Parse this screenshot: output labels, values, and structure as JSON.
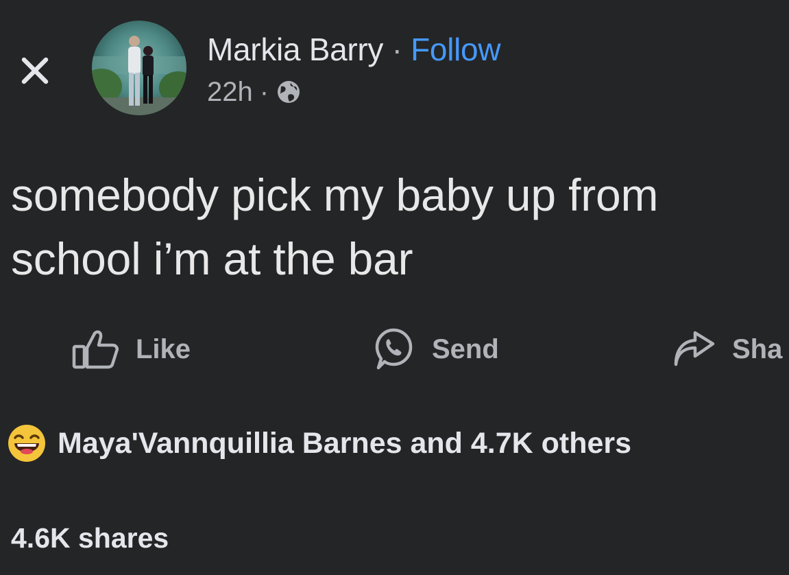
{
  "post": {
    "author_name": "Markia Barry",
    "separator": "·",
    "follow_label": "Follow",
    "timestamp": "22h",
    "meta_separator": "·",
    "privacy_icon": "globe-icon",
    "text_lines": [
      "somebody pick my baby up from",
      "school i’m at the bar"
    ]
  },
  "actions": {
    "like_label": "Like",
    "send_label": "Send",
    "share_label": "Sha"
  },
  "engagement": {
    "reaction_emoji": "grinning-squinting-face",
    "reactions_text": "Maya'Vannquillia Barnes and 4.7K others",
    "shares_text": "4.6K shares"
  },
  "colors": {
    "background": "#242526",
    "primary_text": "#e4e6eb",
    "secondary_text": "#b0b3b8",
    "link": "#4599ff"
  },
  "icons": {
    "close": "close-icon",
    "like": "thumbs-up-icon",
    "send": "whatsapp-icon",
    "share": "share-arrow-icon"
  }
}
